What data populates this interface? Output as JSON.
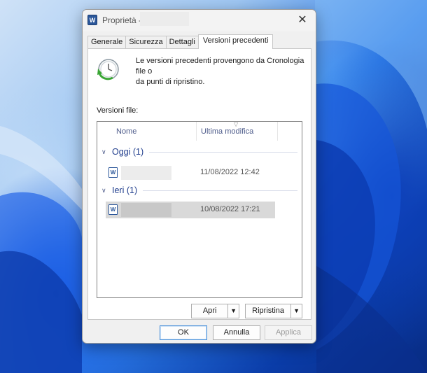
{
  "window": {
    "title": "Proprietà - ",
    "app_icon": "word-icon",
    "close_glyph": "✕"
  },
  "tabs": [
    {
      "label": "Generale",
      "active": false
    },
    {
      "label": "Sicurezza",
      "active": false
    },
    {
      "label": "Dettagli",
      "active": false
    },
    {
      "label": "Versioni precedenti",
      "active": true
    }
  ],
  "panel": {
    "description_line1": "Le versioni precedenti provengono da Cronologia file o",
    "description_line2": "da punti di ripristino.",
    "versions_label": "Versioni file:",
    "columns": {
      "name": "Nome",
      "modified": "Ultima modifica"
    },
    "groups": [
      {
        "label": "Oggi (1)",
        "files": [
          {
            "date": "11/08/2022 12:42",
            "selected": false
          }
        ]
      },
      {
        "label": "Ieri (1)",
        "files": [
          {
            "date": "10/08/2022 17:21",
            "selected": true
          }
        ]
      }
    ],
    "open_label": "Apri",
    "restore_label": "Ripristina"
  },
  "footer": {
    "ok_label": "OK",
    "cancel_label": "Annulla",
    "apply_label": "Applica"
  },
  "colors": {
    "accent": "#2b579a",
    "group_text": "#1e3c8c",
    "selection": "#d9d9d9"
  }
}
